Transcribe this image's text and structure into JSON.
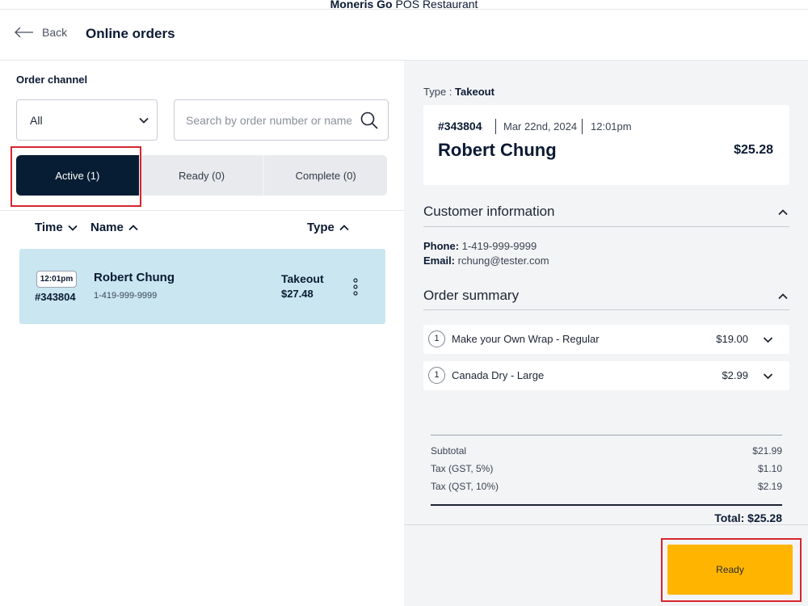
{
  "app": {
    "brand_bold": "Moneris Go",
    "brand_rest": " POS Restaurant"
  },
  "header": {
    "back_label": "Back",
    "title": "Online orders"
  },
  "filters": {
    "channel_label": "Order channel",
    "channel_value": "All",
    "search_placeholder": "Search by order number or name"
  },
  "tabs": [
    {
      "label": "Active (1)",
      "active": true
    },
    {
      "label": "Ready (0)",
      "active": false
    },
    {
      "label": "Complete (0)",
      "active": false
    }
  ],
  "columns": {
    "time": "Time",
    "name": "Name",
    "type": "Type"
  },
  "orders": [
    {
      "time": "12:01pm",
      "number": "#343804",
      "name": "Robert Chung",
      "phone": "1-419-999-9999",
      "type": "Takeout",
      "price": "$27.48"
    }
  ],
  "detail": {
    "type_prefix": "Type : ",
    "type_value": "Takeout",
    "number": "#343804",
    "date": "Mar 22nd, 2024",
    "time": "12:01pm",
    "name": "Robert Chung",
    "total": "$25.28",
    "customer_title": "Customer information",
    "phone_label": "Phone:",
    "phone": " 1-419-999-9999",
    "email_label": "Email:",
    "email": " rchung@tester.com",
    "summary_title": "Order summary",
    "items": [
      {
        "qty": "1",
        "name": "Make your Own Wrap - Regular",
        "price": "$19.00"
      },
      {
        "qty": "1",
        "name": "Canada Dry - Large",
        "price": "$2.99"
      }
    ],
    "totals": [
      {
        "label": "Subtotal",
        "value": "$21.99"
      },
      {
        "label": "Tax (GST, 5%)",
        "value": "$1.10"
      },
      {
        "label": "Tax (QST, 10%)",
        "value": "$2.19"
      }
    ],
    "grand_total": "Total: $25.28",
    "ready_button": "Ready"
  },
  "colors": {
    "navy": "#071d33",
    "card_blue": "#c9e6f1",
    "ready_yellow": "#ffb500",
    "highlight_red": "#d7262e"
  }
}
